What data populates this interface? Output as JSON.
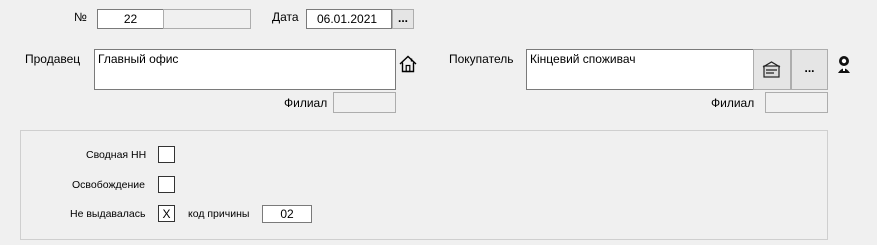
{
  "header": {
    "number_label": "№",
    "number_value": "22",
    "number_suffix": "",
    "date_label": "Дата",
    "date_value": "06.01.2021",
    "date_button": "..."
  },
  "seller": {
    "label": "Продавец",
    "value": "Главный офис",
    "home_icon": "home-icon",
    "branch_label": "Филиал",
    "branch_value": ""
  },
  "buyer": {
    "label": "Покупатель",
    "value": "Кінцевий споживач",
    "card_icon": "address-card-icon",
    "browse_button": "...",
    "person_icon": "person-icon",
    "branch_label": "Филиал",
    "branch_value": ""
  },
  "options": {
    "consolidated_label": "Сводная НН",
    "consolidated_checked": "",
    "exemption_label": "Освобождение",
    "exemption_checked": "",
    "not_issued_label": "Не выдавалась",
    "not_issued_mark": "X",
    "reason_code_label": "код причины",
    "reason_code_value": "02"
  }
}
